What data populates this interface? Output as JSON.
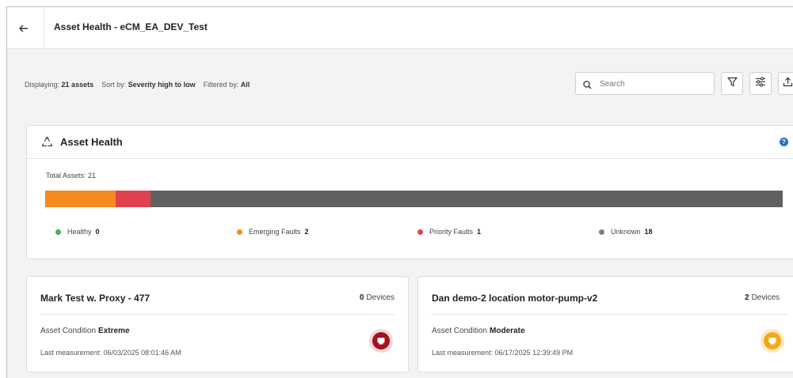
{
  "header": {
    "title": "Asset Health - eCM_EA_DEV_Test",
    "back_icon": "arrow-left-icon"
  },
  "info": {
    "displaying_label": "Displaying:",
    "displaying_value": "21 assets",
    "sort_label": "Sort by:",
    "sort_value": "Severity high to low",
    "filter_label": "Filtered by:",
    "filter_value": "All"
  },
  "search": {
    "placeholder": "Search",
    "value": ""
  },
  "toolbar": {
    "icons": [
      "filter-icon",
      "sliders-icon",
      "export-icon"
    ]
  },
  "health": {
    "title": "Asset Health",
    "icon": "recycle-icon",
    "help_icon": "help-icon",
    "help_text": "?",
    "total_label": "Total Assets: 21",
    "segments": [
      {
        "name": "Healthy",
        "count": "0",
        "value": 0,
        "color": "#4caf50"
      },
      {
        "name": "Emerging Faults",
        "count": "2",
        "value": 2,
        "color": "#f58a1f"
      },
      {
        "name": "Priority Faults",
        "count": "1",
        "value": 1,
        "color": "#e0424f"
      },
      {
        "name": "Unknown",
        "count": "18",
        "value": 18,
        "color": "#606060"
      }
    ]
  },
  "cards": [
    {
      "title": "Mark Test w. Proxy - 477",
      "devices_count": "0",
      "devices_label": "Devices",
      "condition_label": "Asset Condition",
      "condition_value": "Extreme",
      "measurement": "Last measurement: 06/03/2025 08:01:46 AM",
      "status_color": "#a3131c",
      "status_ring": "#f6d6d9"
    },
    {
      "title": "Dan demo-2 location motor-pump-v2",
      "devices_count": "2",
      "devices_label": "Devices",
      "condition_label": "Asset Condition",
      "condition_value": "Moderate",
      "measurement": "Last measurement: 06/17/2025 12:39:49 PM",
      "status_color": "#f0a81c",
      "status_ring": "#fbe9c3"
    }
  ]
}
